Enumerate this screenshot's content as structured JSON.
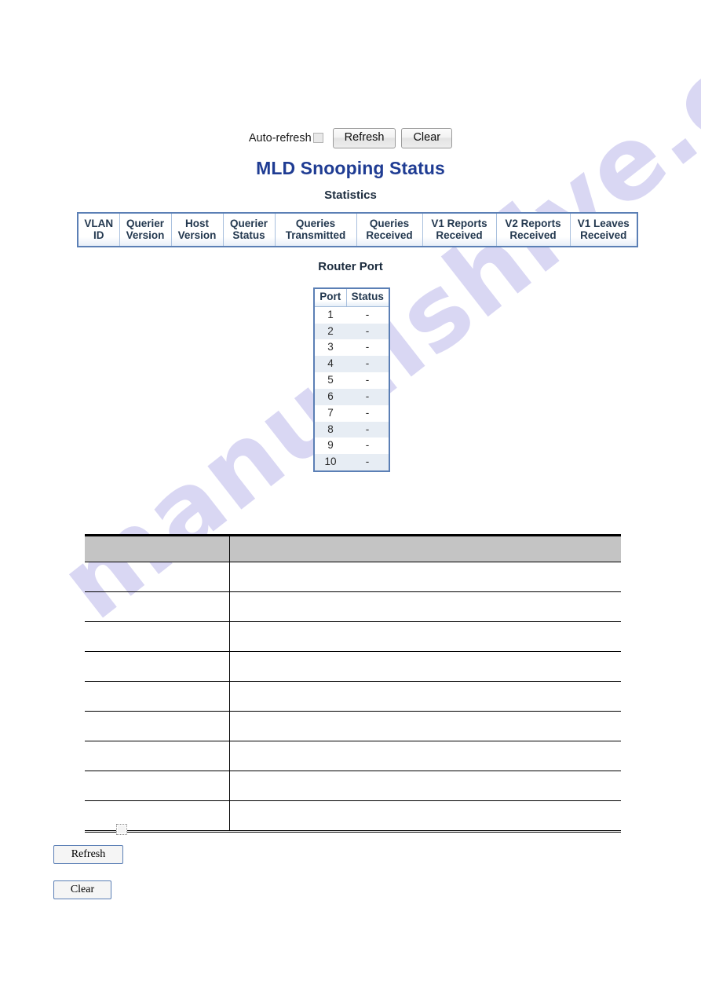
{
  "toolbar": {
    "auto_refresh_label": "Auto-refresh",
    "auto_refresh_checked": false,
    "refresh_label": "Refresh",
    "clear_label": "Clear"
  },
  "page": {
    "title": "MLD Snooping Status",
    "title_color": "#1f3c93"
  },
  "statistics": {
    "heading": "Statistics",
    "columns": [
      {
        "line1": "VLAN",
        "line2": "ID"
      },
      {
        "line1": "Querier",
        "line2": "Version"
      },
      {
        "line1": "Host",
        "line2": "Version"
      },
      {
        "line1": "Querier",
        "line2": "Status"
      },
      {
        "line1": "Queries",
        "line2": "Transmitted"
      },
      {
        "line1": "Queries",
        "line2": "Received"
      },
      {
        "line1": "V1 Reports",
        "line2": "Received"
      },
      {
        "line1": "V2 Reports",
        "line2": "Received"
      },
      {
        "line1": "V1 Leaves",
        "line2": "Received"
      }
    ],
    "rows": []
  },
  "router_port": {
    "heading": "Router Port",
    "columns": [
      "Port",
      "Status"
    ],
    "rows": [
      {
        "port": "1",
        "status": "-"
      },
      {
        "port": "2",
        "status": "-"
      },
      {
        "port": "3",
        "status": "-"
      },
      {
        "port": "4",
        "status": "-"
      },
      {
        "port": "5",
        "status": "-"
      },
      {
        "port": "6",
        "status": "-"
      },
      {
        "port": "7",
        "status": "-"
      },
      {
        "port": "8",
        "status": "-"
      },
      {
        "port": "9",
        "status": "-"
      },
      {
        "port": "10",
        "status": "-"
      }
    ]
  },
  "doc_table": {
    "header": [
      "",
      ""
    ],
    "rows": [
      [
        "",
        ""
      ],
      [
        "",
        ""
      ],
      [
        "",
        ""
      ],
      [
        "",
        ""
      ],
      [
        "",
        ""
      ],
      [
        "",
        ""
      ],
      [
        "",
        ""
      ],
      [
        "",
        ""
      ],
      [
        "",
        ""
      ]
    ]
  },
  "doc_controls": {
    "checkbox_checked": false,
    "refresh_label": "Refresh",
    "clear_label": "Clear"
  },
  "watermark": {
    "text": "manualshive.com",
    "color": "#cdcaf0"
  }
}
